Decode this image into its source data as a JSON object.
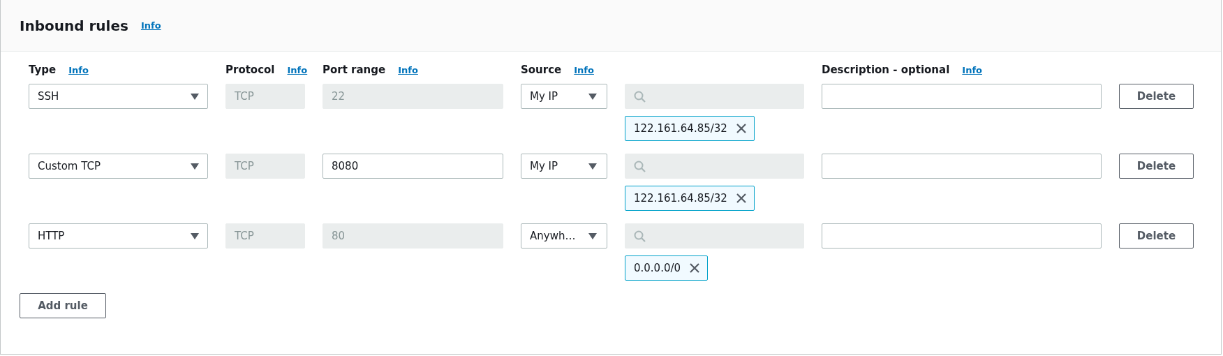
{
  "panel": {
    "title": "Inbound rules",
    "info": "Info"
  },
  "columns": [
    {
      "label": "Type",
      "info": "Info"
    },
    {
      "label": "Protocol",
      "info": "Info"
    },
    {
      "label": "Port range",
      "info": "Info"
    },
    {
      "label": "Source",
      "info": "Info"
    },
    {
      "label": "Description - optional",
      "info": "Info"
    }
  ],
  "rules": [
    {
      "type": "SSH",
      "protocol": "TCP",
      "port_range": {
        "value": "22",
        "disabled": true
      },
      "source": "My IP",
      "cidrs": [
        "122.161.64.85/32"
      ],
      "delete_label": "Delete"
    },
    {
      "type": "Custom TCP",
      "protocol": "TCP",
      "port_range": {
        "value": "8080",
        "disabled": false
      },
      "source": "My IP",
      "cidrs": [
        "122.161.64.85/32"
      ],
      "delete_label": "Delete"
    },
    {
      "type": "HTTP",
      "protocol": "TCP",
      "port_range": {
        "value": "80",
        "disabled": true
      },
      "source": "Anywh…",
      "cidrs": [
        "0.0.0.0/0"
      ],
      "delete_label": "Delete"
    }
  ],
  "add_button": "Add rule"
}
